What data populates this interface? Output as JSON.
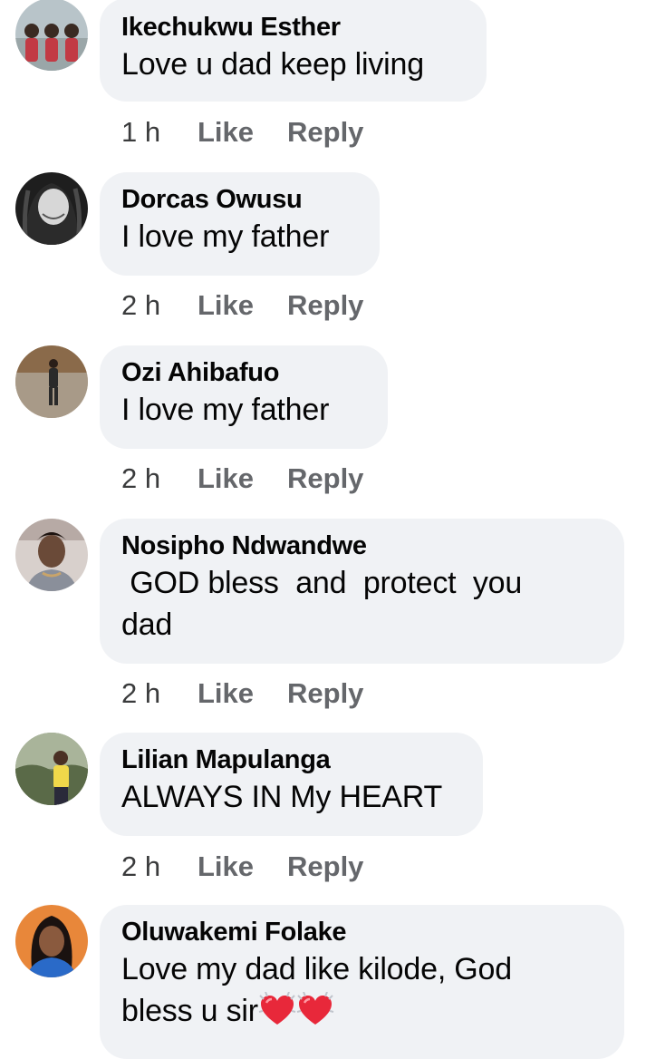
{
  "comments": [
    {
      "author": "Ikechukwu Esther",
      "text": "Love u dad keep living",
      "time": "1 h",
      "like_label": "Like",
      "reply_label": "Reply",
      "avatar_icon": "avatar-three-women"
    },
    {
      "author": "Dorcas Owusu",
      "text": "I love my father",
      "time": "2 h",
      "like_label": "Like",
      "reply_label": "Reply",
      "avatar_icon": "avatar-woman-bw"
    },
    {
      "author": "Ozi Ahibafuo",
      "text": "I love my father",
      "time": "2 h",
      "like_label": "Like",
      "reply_label": "Reply",
      "avatar_icon": "avatar-woman-street"
    },
    {
      "author": "Nosipho Ndwandwe",
      "text": " GOD bless  and  protect  you\ndad",
      "time": "2 h",
      "like_label": "Like",
      "reply_label": "Reply",
      "avatar_icon": "avatar-woman-selfie"
    },
    {
      "author": "Lilian Mapulanga",
      "text": "ALWAYS IN My HEART",
      "time": "2 h",
      "like_label": "Like",
      "reply_label": "Reply",
      "avatar_icon": "avatar-woman-yellow"
    },
    {
      "author": "Oluwakemi Folake",
      "text": "Love my dad like kilode, God\nbless u sir",
      "emoji": "sparkling-heart-icon x2",
      "time": "",
      "like_label": "",
      "reply_label": "",
      "avatar_icon": "avatar-woman-orange-bg"
    }
  ],
  "colors": {
    "bubble": "#f0f2f5",
    "author": "#050505",
    "meta": "#65676b",
    "heart": "#e8283a"
  }
}
